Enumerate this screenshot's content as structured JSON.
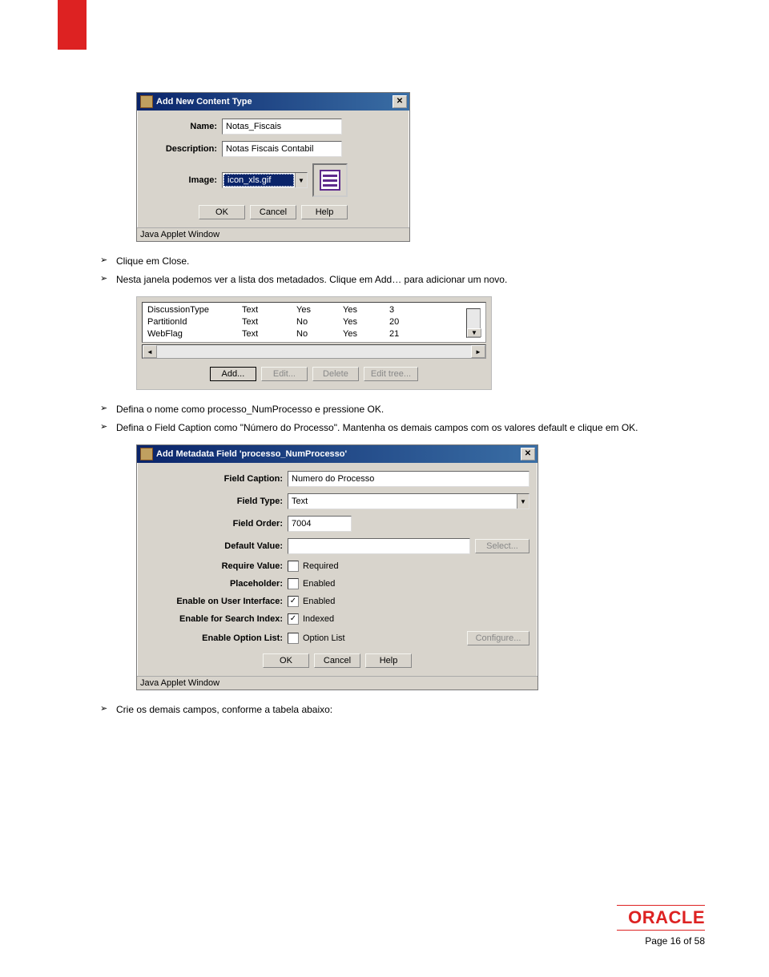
{
  "bullets1": {
    "b1": "Clique em Close.",
    "b2": "Nesta janela podemos ver a lista dos metadados. Clique em Add… para adicionar um novo."
  },
  "dialog1": {
    "title": "Add New Content Type",
    "name_label": "Name:",
    "name_value": "Notas_Fiscais",
    "desc_label": "Description:",
    "desc_value": "Notas Fiscais Contabil",
    "image_label": "Image:",
    "image_value": "icon_xls.gif",
    "ok": "OK",
    "cancel": "Cancel",
    "help": "Help",
    "status": "Java Applet Window"
  },
  "panel": {
    "rows": [
      {
        "c1": "DiscussionType",
        "c2": "Text",
        "c3": "Yes",
        "c4": "Yes",
        "c5": "3"
      },
      {
        "c1": "PartitionId",
        "c2": "Text",
        "c3": "No",
        "c4": "Yes",
        "c5": "20"
      },
      {
        "c1": "WebFlag",
        "c2": "Text",
        "c3": "No",
        "c4": "Yes",
        "c5": "21"
      }
    ],
    "btn_add": "Add...",
    "btn_edit": "Edit...",
    "btn_delete": "Delete",
    "btn_edittree": "Edit tree..."
  },
  "bullets2": {
    "b1": "Defina o nome como processo_NumProcesso e pressione OK.",
    "b2": "Defina o Field Caption como \"Número do Processo\". Mantenha os demais campos com os valores default e clique em OK."
  },
  "dialog2": {
    "title": "Add Metadata Field 'processo_NumProcesso'",
    "fields": {
      "caption_lbl": "Field Caption:",
      "caption_val": "Numero do Processo",
      "type_lbl": "Field Type:",
      "type_val": "Text",
      "order_lbl": "Field Order:",
      "order_val": "7004",
      "default_lbl": "Default Value:",
      "default_val": "",
      "select_btn": "Select...",
      "require_lbl": "Require Value:",
      "require_cb": "Required",
      "placeholder_lbl": "Placeholder:",
      "placeholder_cb": "Enabled",
      "ui_lbl": "Enable on User Interface:",
      "ui_cb": "Enabled",
      "search_lbl": "Enable for Search Index:",
      "search_cb": "Indexed",
      "option_lbl": "Enable Option List:",
      "option_cb": "Option List",
      "configure_btn": "Configure..."
    },
    "ok": "OK",
    "cancel": "Cancel",
    "help": "Help",
    "status": "Java Applet Window"
  },
  "bullets3": {
    "b1": "Crie os demais campos, conforme a tabela abaixo:"
  },
  "footer": {
    "logo": "ORACLE",
    "page": "Page 16 of 58"
  }
}
